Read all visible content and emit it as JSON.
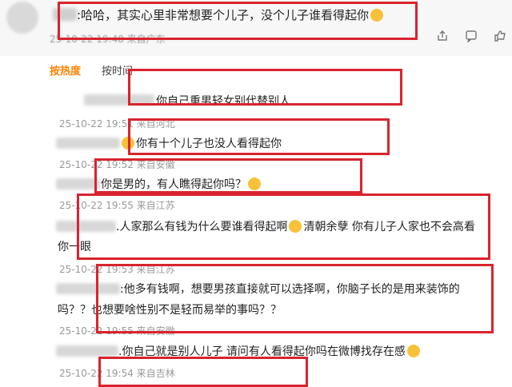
{
  "top_comment": {
    "text": ":哈哈，其实心里非常想要个儿子，没个儿子谁看得起你",
    "meta": "25-10-22 19:48 来自广东"
  },
  "tabs": {
    "hot": "按热度",
    "time": "按时间"
  },
  "replies": [
    {
      "text": "你自己重男轻女别代替别人",
      "meta": "25-10-22 19:51 来自河北"
    },
    {
      "text": "你有十个儿子也没人看得起你",
      "meta": "25-10-22 19:52 来自安徽"
    },
    {
      "text": "你是男的，有人瞧得起你吗？",
      "meta": "25-10-22 19:55 来自江苏"
    },
    {
      "text": ".人家那么有钱为什么要谁看得起啊",
      "text_b": "清朝余孽 你有儿子人家也不会高看",
      "text_c": "你一眼",
      "meta": "25-10-22 19:53 来自江苏"
    },
    {
      "text": ":他多有钱啊，想要男孩直接就可以选择啊，你脑子长的是用来装饰的",
      "text_b": "吗？？也想要啥性别不是轻而易举的事吗？？",
      "meta": "25-10-22 19:55 来自安徽"
    },
    {
      "text": ".你自己就是别人儿子 请问有人看得起你吗在微博找存在感",
      "meta": "25-10-22 19:54 来自吉林"
    }
  ],
  "icons": [
    "share-icon",
    "comment-icon",
    "like-icon"
  ]
}
